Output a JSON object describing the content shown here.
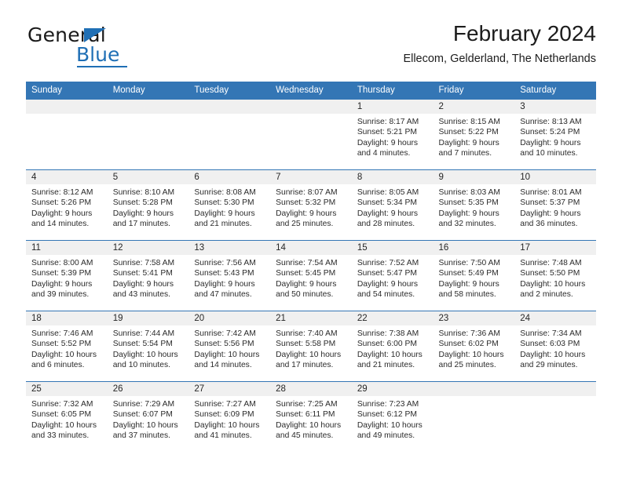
{
  "brand": {
    "name_part1": "General",
    "name_part2": "Blue",
    "triangle_color": "#1f6fb5"
  },
  "header": {
    "title": "February 2024",
    "subtitle": "Ellecom, Gelderland, The Netherlands"
  },
  "theme": {
    "header_blue": "#3476b5",
    "daynum_band": "#f0f0f0",
    "text": "#2b2b2b"
  },
  "calendar": {
    "weekday_headers": [
      "Sunday",
      "Monday",
      "Tuesday",
      "Wednesday",
      "Thursday",
      "Friday",
      "Saturday"
    ],
    "weeks": [
      [
        {
          "day": "",
          "sunrise": "",
          "sunset": "",
          "daylight_line1": "",
          "daylight_line2": "",
          "empty": true
        },
        {
          "day": "",
          "sunrise": "",
          "sunset": "",
          "daylight_line1": "",
          "daylight_line2": "",
          "empty": true
        },
        {
          "day": "",
          "sunrise": "",
          "sunset": "",
          "daylight_line1": "",
          "daylight_line2": "",
          "empty": true
        },
        {
          "day": "",
          "sunrise": "",
          "sunset": "",
          "daylight_line1": "",
          "daylight_line2": "",
          "empty": true
        },
        {
          "day": "1",
          "sunrise": "Sunrise: 8:17 AM",
          "sunset": "Sunset: 5:21 PM",
          "daylight_line1": "Daylight: 9 hours",
          "daylight_line2": "and 4 minutes.",
          "empty": false
        },
        {
          "day": "2",
          "sunrise": "Sunrise: 8:15 AM",
          "sunset": "Sunset: 5:22 PM",
          "daylight_line1": "Daylight: 9 hours",
          "daylight_line2": "and 7 minutes.",
          "empty": false
        },
        {
          "day": "3",
          "sunrise": "Sunrise: 8:13 AM",
          "sunset": "Sunset: 5:24 PM",
          "daylight_line1": "Daylight: 9 hours",
          "daylight_line2": "and 10 minutes.",
          "empty": false
        }
      ],
      [
        {
          "day": "4",
          "sunrise": "Sunrise: 8:12 AM",
          "sunset": "Sunset: 5:26 PM",
          "daylight_line1": "Daylight: 9 hours",
          "daylight_line2": "and 14 minutes.",
          "empty": false
        },
        {
          "day": "5",
          "sunrise": "Sunrise: 8:10 AM",
          "sunset": "Sunset: 5:28 PM",
          "daylight_line1": "Daylight: 9 hours",
          "daylight_line2": "and 17 minutes.",
          "empty": false
        },
        {
          "day": "6",
          "sunrise": "Sunrise: 8:08 AM",
          "sunset": "Sunset: 5:30 PM",
          "daylight_line1": "Daylight: 9 hours",
          "daylight_line2": "and 21 minutes.",
          "empty": false
        },
        {
          "day": "7",
          "sunrise": "Sunrise: 8:07 AM",
          "sunset": "Sunset: 5:32 PM",
          "daylight_line1": "Daylight: 9 hours",
          "daylight_line2": "and 25 minutes.",
          "empty": false
        },
        {
          "day": "8",
          "sunrise": "Sunrise: 8:05 AM",
          "sunset": "Sunset: 5:34 PM",
          "daylight_line1": "Daylight: 9 hours",
          "daylight_line2": "and 28 minutes.",
          "empty": false
        },
        {
          "day": "9",
          "sunrise": "Sunrise: 8:03 AM",
          "sunset": "Sunset: 5:35 PM",
          "daylight_line1": "Daylight: 9 hours",
          "daylight_line2": "and 32 minutes.",
          "empty": false
        },
        {
          "day": "10",
          "sunrise": "Sunrise: 8:01 AM",
          "sunset": "Sunset: 5:37 PM",
          "daylight_line1": "Daylight: 9 hours",
          "daylight_line2": "and 36 minutes.",
          "empty": false
        }
      ],
      [
        {
          "day": "11",
          "sunrise": "Sunrise: 8:00 AM",
          "sunset": "Sunset: 5:39 PM",
          "daylight_line1": "Daylight: 9 hours",
          "daylight_line2": "and 39 minutes.",
          "empty": false
        },
        {
          "day": "12",
          "sunrise": "Sunrise: 7:58 AM",
          "sunset": "Sunset: 5:41 PM",
          "daylight_line1": "Daylight: 9 hours",
          "daylight_line2": "and 43 minutes.",
          "empty": false
        },
        {
          "day": "13",
          "sunrise": "Sunrise: 7:56 AM",
          "sunset": "Sunset: 5:43 PM",
          "daylight_line1": "Daylight: 9 hours",
          "daylight_line2": "and 47 minutes.",
          "empty": false
        },
        {
          "day": "14",
          "sunrise": "Sunrise: 7:54 AM",
          "sunset": "Sunset: 5:45 PM",
          "daylight_line1": "Daylight: 9 hours",
          "daylight_line2": "and 50 minutes.",
          "empty": false
        },
        {
          "day": "15",
          "sunrise": "Sunrise: 7:52 AM",
          "sunset": "Sunset: 5:47 PM",
          "daylight_line1": "Daylight: 9 hours",
          "daylight_line2": "and 54 minutes.",
          "empty": false
        },
        {
          "day": "16",
          "sunrise": "Sunrise: 7:50 AM",
          "sunset": "Sunset: 5:49 PM",
          "daylight_line1": "Daylight: 9 hours",
          "daylight_line2": "and 58 minutes.",
          "empty": false
        },
        {
          "day": "17",
          "sunrise": "Sunrise: 7:48 AM",
          "sunset": "Sunset: 5:50 PM",
          "daylight_line1": "Daylight: 10 hours",
          "daylight_line2": "and 2 minutes.",
          "empty": false
        }
      ],
      [
        {
          "day": "18",
          "sunrise": "Sunrise: 7:46 AM",
          "sunset": "Sunset: 5:52 PM",
          "daylight_line1": "Daylight: 10 hours",
          "daylight_line2": "and 6 minutes.",
          "empty": false
        },
        {
          "day": "19",
          "sunrise": "Sunrise: 7:44 AM",
          "sunset": "Sunset: 5:54 PM",
          "daylight_line1": "Daylight: 10 hours",
          "daylight_line2": "and 10 minutes.",
          "empty": false
        },
        {
          "day": "20",
          "sunrise": "Sunrise: 7:42 AM",
          "sunset": "Sunset: 5:56 PM",
          "daylight_line1": "Daylight: 10 hours",
          "daylight_line2": "and 14 minutes.",
          "empty": false
        },
        {
          "day": "21",
          "sunrise": "Sunrise: 7:40 AM",
          "sunset": "Sunset: 5:58 PM",
          "daylight_line1": "Daylight: 10 hours",
          "daylight_line2": "and 17 minutes.",
          "empty": false
        },
        {
          "day": "22",
          "sunrise": "Sunrise: 7:38 AM",
          "sunset": "Sunset: 6:00 PM",
          "daylight_line1": "Daylight: 10 hours",
          "daylight_line2": "and 21 minutes.",
          "empty": false
        },
        {
          "day": "23",
          "sunrise": "Sunrise: 7:36 AM",
          "sunset": "Sunset: 6:02 PM",
          "daylight_line1": "Daylight: 10 hours",
          "daylight_line2": "and 25 minutes.",
          "empty": false
        },
        {
          "day": "24",
          "sunrise": "Sunrise: 7:34 AM",
          "sunset": "Sunset: 6:03 PM",
          "daylight_line1": "Daylight: 10 hours",
          "daylight_line2": "and 29 minutes.",
          "empty": false
        }
      ],
      [
        {
          "day": "25",
          "sunrise": "Sunrise: 7:32 AM",
          "sunset": "Sunset: 6:05 PM",
          "daylight_line1": "Daylight: 10 hours",
          "daylight_line2": "and 33 minutes.",
          "empty": false
        },
        {
          "day": "26",
          "sunrise": "Sunrise: 7:29 AM",
          "sunset": "Sunset: 6:07 PM",
          "daylight_line1": "Daylight: 10 hours",
          "daylight_line2": "and 37 minutes.",
          "empty": false
        },
        {
          "day": "27",
          "sunrise": "Sunrise: 7:27 AM",
          "sunset": "Sunset: 6:09 PM",
          "daylight_line1": "Daylight: 10 hours",
          "daylight_line2": "and 41 minutes.",
          "empty": false
        },
        {
          "day": "28",
          "sunrise": "Sunrise: 7:25 AM",
          "sunset": "Sunset: 6:11 PM",
          "daylight_line1": "Daylight: 10 hours",
          "daylight_line2": "and 45 minutes.",
          "empty": false
        },
        {
          "day": "29",
          "sunrise": "Sunrise: 7:23 AM",
          "sunset": "Sunset: 6:12 PM",
          "daylight_line1": "Daylight: 10 hours",
          "daylight_line2": "and 49 minutes.",
          "empty": false
        },
        {
          "day": "",
          "sunrise": "",
          "sunset": "",
          "daylight_line1": "",
          "daylight_line2": "",
          "empty": true
        },
        {
          "day": "",
          "sunrise": "",
          "sunset": "",
          "daylight_line1": "",
          "daylight_line2": "",
          "empty": true
        }
      ]
    ]
  }
}
